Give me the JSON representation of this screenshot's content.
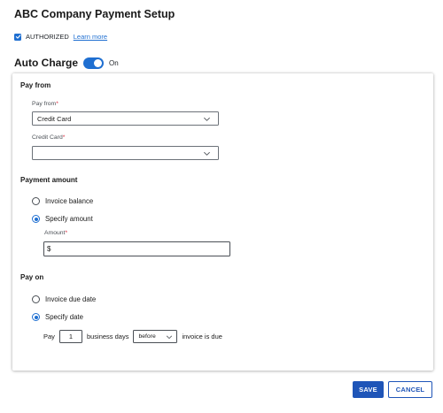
{
  "header": {
    "title": "ABC Company Payment Setup"
  },
  "authorized": {
    "label": "AUTHORIZED",
    "link": "Learn more",
    "checked": true
  },
  "auto_charge": {
    "label": "Auto Charge",
    "state": "On",
    "enabled": true
  },
  "pay_from": {
    "section_title": "Pay from",
    "pay_from_label": "Pay from",
    "pay_from_value": "Credit Card",
    "credit_card_label": "Credit Card",
    "credit_card_value": "",
    "required_mark": "*"
  },
  "payment_amount": {
    "section_title": "Payment amount",
    "options": [
      "Invoice balance",
      "Specify amount"
    ],
    "selected": "Specify amount",
    "amount_label": "Amount",
    "amount_value": "$"
  },
  "pay_on": {
    "section_title": "Pay on",
    "options": [
      "Invoice due date",
      "Specify date"
    ],
    "selected": "Specify date",
    "pay_label": "Pay",
    "days_value": "1",
    "business_days_label": "business days",
    "timing_value": "before",
    "suffix_label": "invoice is due"
  },
  "actions": {
    "save": "SAVE",
    "cancel": "CANCEL"
  },
  "colors": {
    "accent": "#1f6fd1",
    "primary_button": "#1f55b8",
    "required": "#d9273b"
  }
}
